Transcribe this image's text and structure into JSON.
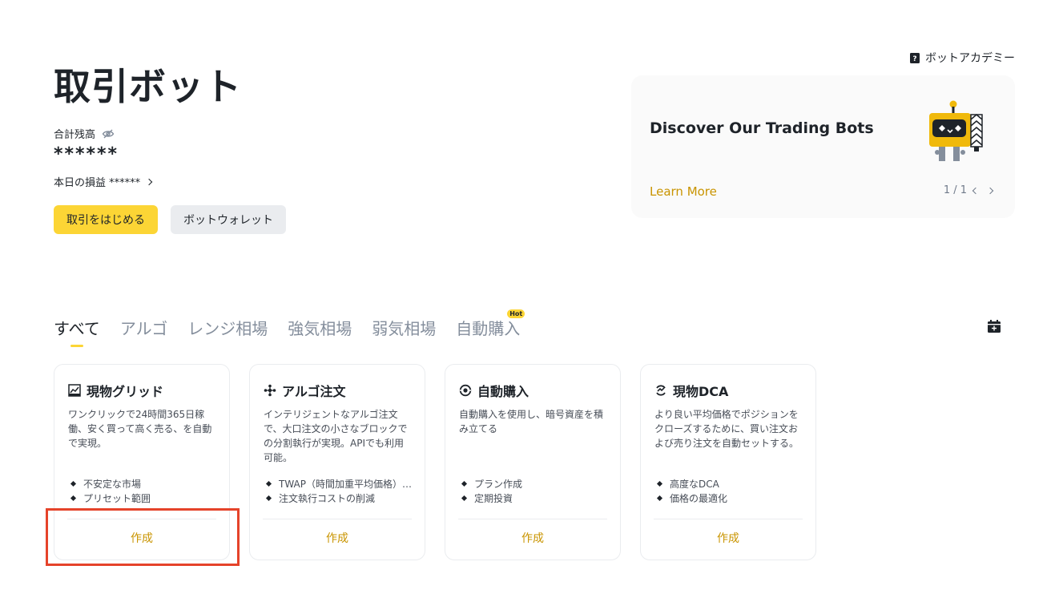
{
  "header": {
    "title": "取引ボット",
    "balance_label": "合計残高",
    "balance_value": "******",
    "pnl_label": "本日の損益 ******",
    "start_button": "取引をはじめる",
    "wallet_button": "ボットウォレット",
    "academy_label": "ボットアカデミー"
  },
  "banner": {
    "title": "Discover Our Trading Bots",
    "link": "Learn More",
    "pager": "1 / 1"
  },
  "tabs": [
    {
      "label": "すべて"
    },
    {
      "label": "アルゴ"
    },
    {
      "label": "レンジ相場"
    },
    {
      "label": "強気相場"
    },
    {
      "label": "弱気相場"
    },
    {
      "label": "自動購入",
      "badge": "Hot"
    }
  ],
  "cards": [
    {
      "icon": "chart-grid-icon",
      "title": "現物グリッド",
      "description": "ワンクリックで24時間365日稼働、安く買って高く売る、を自動で実現。",
      "features": [
        "不安定な市場",
        "プリセット範囲"
      ],
      "action": "作成"
    },
    {
      "icon": "algo-icon",
      "title": "アルゴ注文",
      "description": "インテリジェントなアルゴ注文で、大口注文の小さなブロックでの分割執行が実現。APIでも利用可能。",
      "features": [
        "TWAP（時間加重平均価格）…",
        "注文執行コストの削減"
      ],
      "action": "作成"
    },
    {
      "icon": "auto-invest-icon",
      "title": "自動購入",
      "description": "自動購入を使用し、暗号資産を積み立てる",
      "features": [
        "プラン作成",
        "定期投資"
      ],
      "action": "作成"
    },
    {
      "icon": "dca-icon",
      "title": "現物DCA",
      "description": "より良い平均価格でポジションをクローズするために、買い注文および売り注文を自動セットする。",
      "features": [
        "高度なDCA",
        "価格の最適化"
      ],
      "action": "作成"
    }
  ],
  "colors": {
    "accent": "#fcd535",
    "link": "#c99400",
    "highlight": "#e5432a"
  }
}
